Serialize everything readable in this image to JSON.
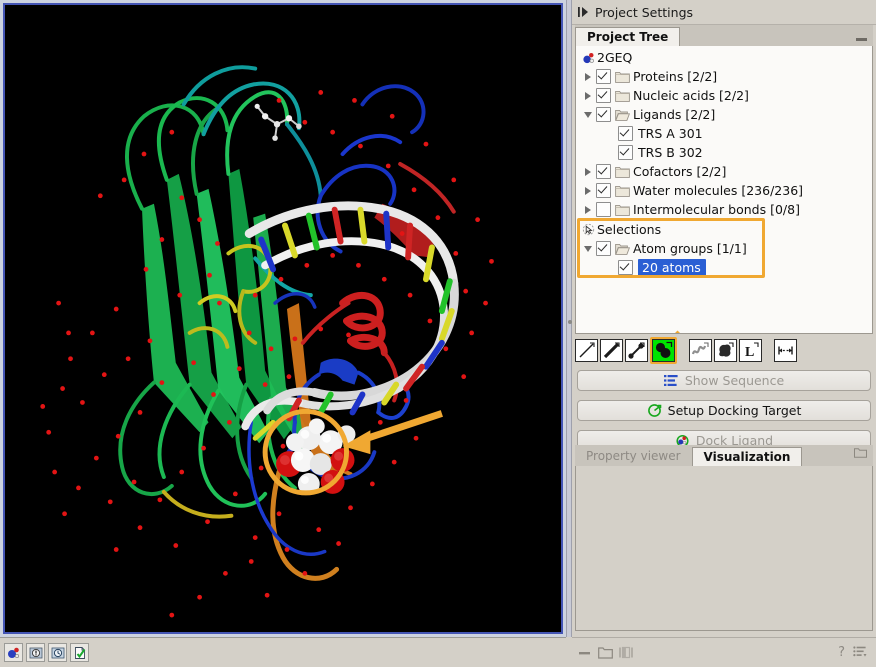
{
  "window": {
    "viewport_background": "#000000",
    "viewport_border_color": "#4455b5",
    "highlight_color": "#f0a832",
    "selection_color": "#2a5fd4"
  },
  "left_status_bar": {
    "buttons": [
      {
        "name": "molecule-icon",
        "title": "3D molecule view"
      },
      {
        "name": "info-icon",
        "title": "Info"
      },
      {
        "name": "history-icon",
        "title": "History"
      },
      {
        "name": "checklist-icon",
        "title": "Element info"
      }
    ]
  },
  "project_settings": {
    "title": "Project Settings",
    "collapse_icon": "expand-arrow-icon"
  },
  "project_tree_panel": {
    "tabs": [
      {
        "label": "Project Tree",
        "active": true
      }
    ],
    "minimize_label": "minimize"
  },
  "tree": {
    "root": {
      "label": "2GEQ",
      "icon": "molecule-icon"
    },
    "nodes": [
      {
        "label": "Proteins [2/2]",
        "checked": true,
        "expandable": true,
        "expanded": false,
        "indent": 1,
        "icon": "folder-icon"
      },
      {
        "label": "Nucleic acids [2/2]",
        "checked": true,
        "expandable": true,
        "expanded": false,
        "indent": 1,
        "icon": "folder-icon"
      },
      {
        "label": "Ligands [2/2]",
        "checked": true,
        "expandable": true,
        "expanded": true,
        "indent": 1,
        "icon": "folder-open-icon"
      },
      {
        "label": "TRS A 301",
        "checked": true,
        "expandable": false,
        "expanded": false,
        "indent": 2,
        "icon": "none"
      },
      {
        "label": "TRS B 302",
        "checked": true,
        "expandable": false,
        "expanded": false,
        "indent": 2,
        "icon": "none"
      },
      {
        "label": "Cofactors [2/2]",
        "checked": true,
        "expandable": true,
        "expanded": false,
        "indent": 1,
        "icon": "folder-icon"
      },
      {
        "label": "Water molecules [236/236]",
        "checked": true,
        "expandable": true,
        "expanded": false,
        "indent": 1,
        "icon": "folder-icon"
      },
      {
        "label": "Intermolecular bonds [0/8]",
        "checked": false,
        "expandable": true,
        "expanded": false,
        "indent": 1,
        "icon": "folder-icon"
      }
    ],
    "selections": {
      "label": "Selections",
      "icon": "selection-cursor-icon",
      "highlighted": true,
      "children": [
        {
          "label": "Atom groups [1/1]",
          "checked": true,
          "expandable": true,
          "expanded": true,
          "indent": 1,
          "icon": "folder-open-icon",
          "selected": false
        },
        {
          "label": "20 atoms",
          "checked": true,
          "expandable": false,
          "expanded": false,
          "indent": 2,
          "icon": "none",
          "selected": true
        }
      ]
    }
  },
  "representation_toolbar": {
    "buttons": [
      {
        "name": "wireframe-icon",
        "label": "Wireframe",
        "active": false
      },
      {
        "name": "stick-icon",
        "label": "Stick",
        "active": false
      },
      {
        "name": "ball-and-stick-icon",
        "label": "Ball and stick",
        "active": false
      },
      {
        "name": "space-filling-icon",
        "label": "Space-filling (CPK)",
        "active": true
      },
      {
        "name": "backbone-icon",
        "label": "Backbone",
        "active": false
      },
      {
        "name": "molecular-surface-icon",
        "label": "Molecular surface",
        "active": false
      },
      {
        "name": "label-icon",
        "label": "L",
        "active": false
      },
      {
        "name": "distance-measure-icon",
        "label": "Distance",
        "active": false
      }
    ]
  },
  "actions": {
    "show_sequence": {
      "label": "Show Sequence",
      "icon": "sequence-icon",
      "enabled": false
    },
    "setup_docking_target": {
      "label": "Setup Docking Target",
      "icon": "docking-target-icon",
      "enabled": true
    },
    "dock_ligand": {
      "label": "Dock Ligand",
      "icon": "dock-ligand-icon",
      "enabled": false
    }
  },
  "lower_panel": {
    "tabs": [
      {
        "label": "Property viewer",
        "active": false
      },
      {
        "label": "Visualization",
        "active": true
      }
    ],
    "corner_icon": "folder-icon"
  },
  "right_status_bar": {
    "left_icons": [
      {
        "name": "minimize-icon"
      },
      {
        "name": "folder-icon"
      },
      {
        "name": "split-view-icon"
      }
    ],
    "help_label": "?",
    "menu_icon": "list-menu-icon"
  },
  "annotations": {
    "arrow_to_toolbar": {
      "name": "orange-arrow-to-spacefill-button",
      "color": "#f0a832"
    },
    "arrow_to_molecule": {
      "name": "orange-arrow-to-selected-atoms",
      "color": "#f0a832"
    },
    "circle_on_molecule": {
      "name": "orange-circle-highlight",
      "color": "#f0a832"
    }
  }
}
